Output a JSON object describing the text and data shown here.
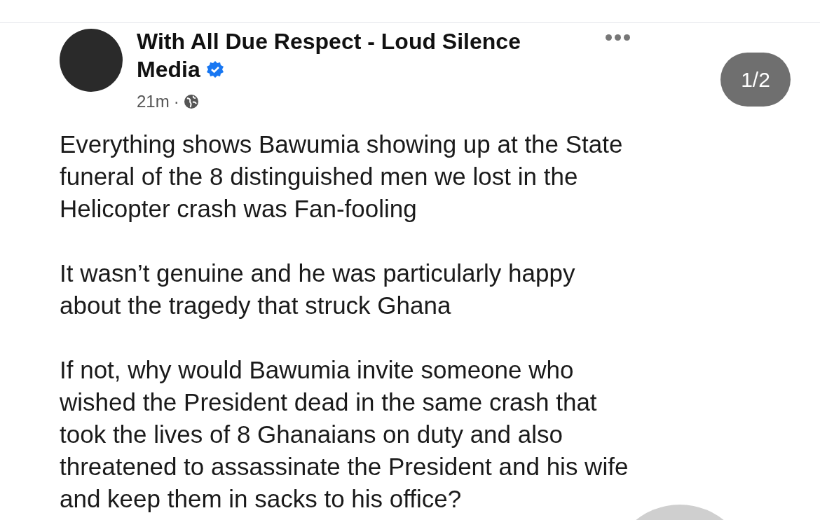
{
  "post": {
    "author": "With All Due Respect - Loud Silence Media",
    "verified": true,
    "time": "21m",
    "separator": "·",
    "paragraphs": [
      "Everything shows Bawumia showing up at the State funeral of the 8 distinguished men we lost in the Helicopter crash was Fan-fooling",
      "It wasn’t genuine and he was particularly happy about the tragedy that struck Ghana",
      "If not, why would Bawumia invite someone who wished the President dead in the same crash that took the lives of 8 Ghanaians on duty and also threatened to assassinate the President and his wife and keep them in sacks to his office?"
    ]
  },
  "pager": "1/2"
}
